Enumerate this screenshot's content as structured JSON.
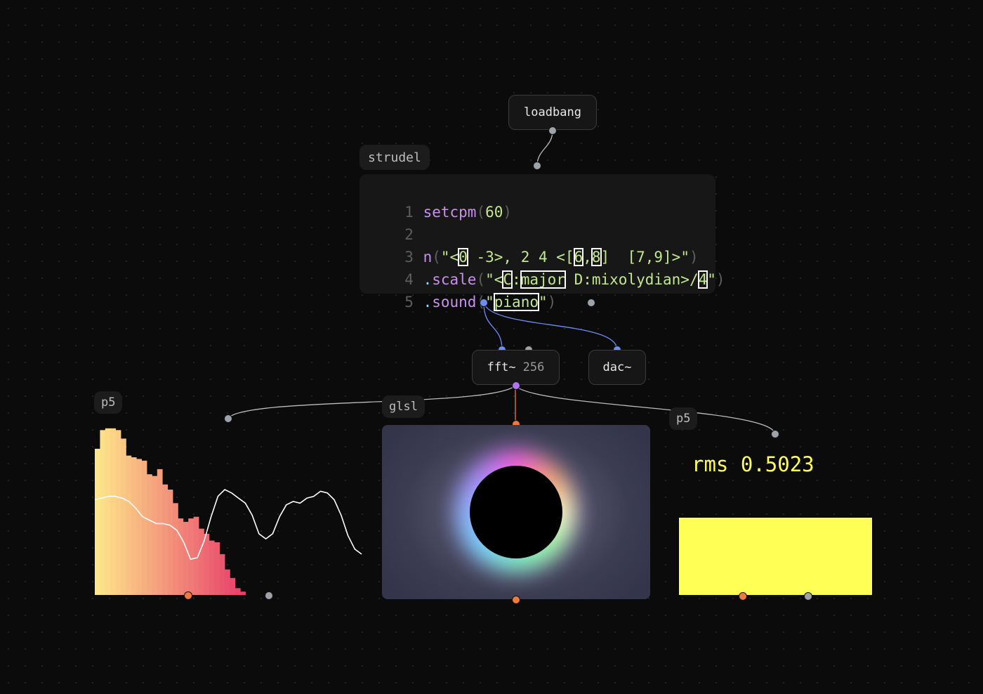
{
  "nodes": {
    "loadbang": {
      "label": "loadbang"
    },
    "strudel": {
      "label": "strudel"
    },
    "fft": {
      "label": "fft~",
      "size": "256"
    },
    "dac": {
      "label": "dac~"
    },
    "p5_left": {
      "label": "p5"
    },
    "glsl": {
      "label": "glsl"
    },
    "p5_right": {
      "label": "p5"
    }
  },
  "code": {
    "line_numbers": [
      "1",
      "2",
      "3",
      "4",
      "5"
    ],
    "line1": {
      "fn": "setcpm",
      "open": "(",
      "arg": "60",
      "close": ")"
    },
    "line3": {
      "fn": "n",
      "open": "(",
      "q1": "\"<",
      "h0": "0",
      "s1": " -3>, 2 4 <[",
      "h6": "6",
      "comma": ",",
      "h8": "8",
      "s2": "]  [7,9]>\"",
      "close": ")"
    },
    "line4": {
      "dot": ".",
      "fn": "scale",
      "open": "(",
      "q1": "\"<",
      "hC": "C",
      "colon": ":",
      "hmajor": "major",
      "s1": " D:mixolydian>/",
      "h4": "4",
      "q2": "\"",
      "close": ")"
    },
    "line5": {
      "dot": ".",
      "fn": "sound",
      "open": "(",
      "q1": "\"",
      "hpiano": "piano",
      "q2": "\"",
      "close": ")"
    }
  },
  "rms": {
    "label": "rms",
    "value": "0.5023"
  },
  "colors": {
    "background": "#0b0b0b",
    "wire": "#bcbcbc",
    "audio_wire": "#6d8ef5",
    "port_gray": "#9ea3ab",
    "port_blue": "#6d8ef5",
    "port_orange": "#f07a3d",
    "port_purple": "#b274f0",
    "rms_yellow": "#ffff55",
    "bars_start": "#fde68a",
    "bars_end": "#e83e6b"
  },
  "spectrum": {
    "bins": [
      0.86,
      0.97,
      0.98,
      0.98,
      0.97,
      0.92,
      0.82,
      0.81,
      0.8,
      0.79,
      0.71,
      0.7,
      0.74,
      0.65,
      0.62,
      0.54,
      0.45,
      0.43,
      0.45,
      0.46,
      0.39,
      0.36,
      0.32,
      0.31,
      0.24,
      0.15,
      0.1,
      0.04,
      0.02
    ],
    "waveform": [
      0.56,
      0.57,
      0.58,
      0.58,
      0.57,
      0.55,
      0.51,
      0.46,
      0.44,
      0.42,
      0.42,
      0.41,
      0.38,
      0.31,
      0.21,
      0.22,
      0.32,
      0.46,
      0.58,
      0.62,
      0.6,
      0.57,
      0.54,
      0.47,
      0.36,
      0.33,
      0.36,
      0.46,
      0.53,
      0.55,
      0.54,
      0.57,
      0.58,
      0.61,
      0.6,
      0.56,
      0.47,
      0.35,
      0.27,
      0.24
    ]
  }
}
